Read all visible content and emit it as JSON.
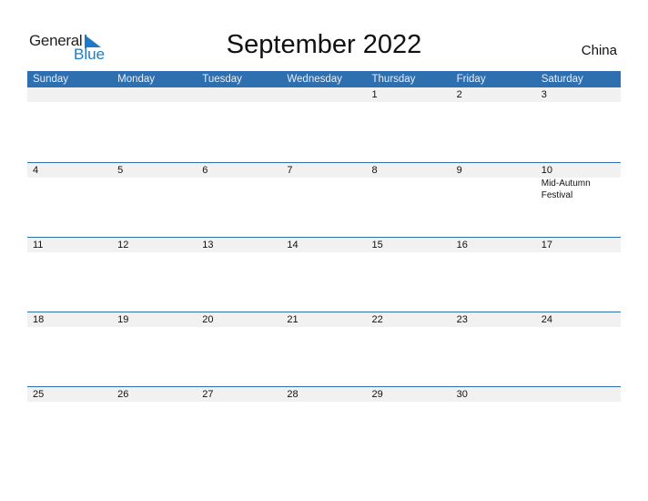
{
  "logo": {
    "general": "General",
    "blue": "Blue"
  },
  "title": "September 2022",
  "country": "China",
  "colors": {
    "header": "#2e6fb0",
    "logo_blue": "#1e7ac8",
    "row_bg": "#f1f1f1"
  },
  "days": [
    "Sunday",
    "Monday",
    "Tuesday",
    "Wednesday",
    "Thursday",
    "Friday",
    "Saturday"
  ],
  "weeks": [
    [
      "",
      "",
      "",
      "",
      "1",
      "2",
      "3"
    ],
    [
      "4",
      "5",
      "6",
      "7",
      "8",
      "9",
      "10"
    ],
    [
      "11",
      "12",
      "13",
      "14",
      "15",
      "16",
      "17"
    ],
    [
      "18",
      "19",
      "20",
      "21",
      "22",
      "23",
      "24"
    ],
    [
      "25",
      "26",
      "27",
      "28",
      "29",
      "30",
      ""
    ]
  ],
  "events": {
    "w1d6": "Mid-Autumn Festival"
  }
}
